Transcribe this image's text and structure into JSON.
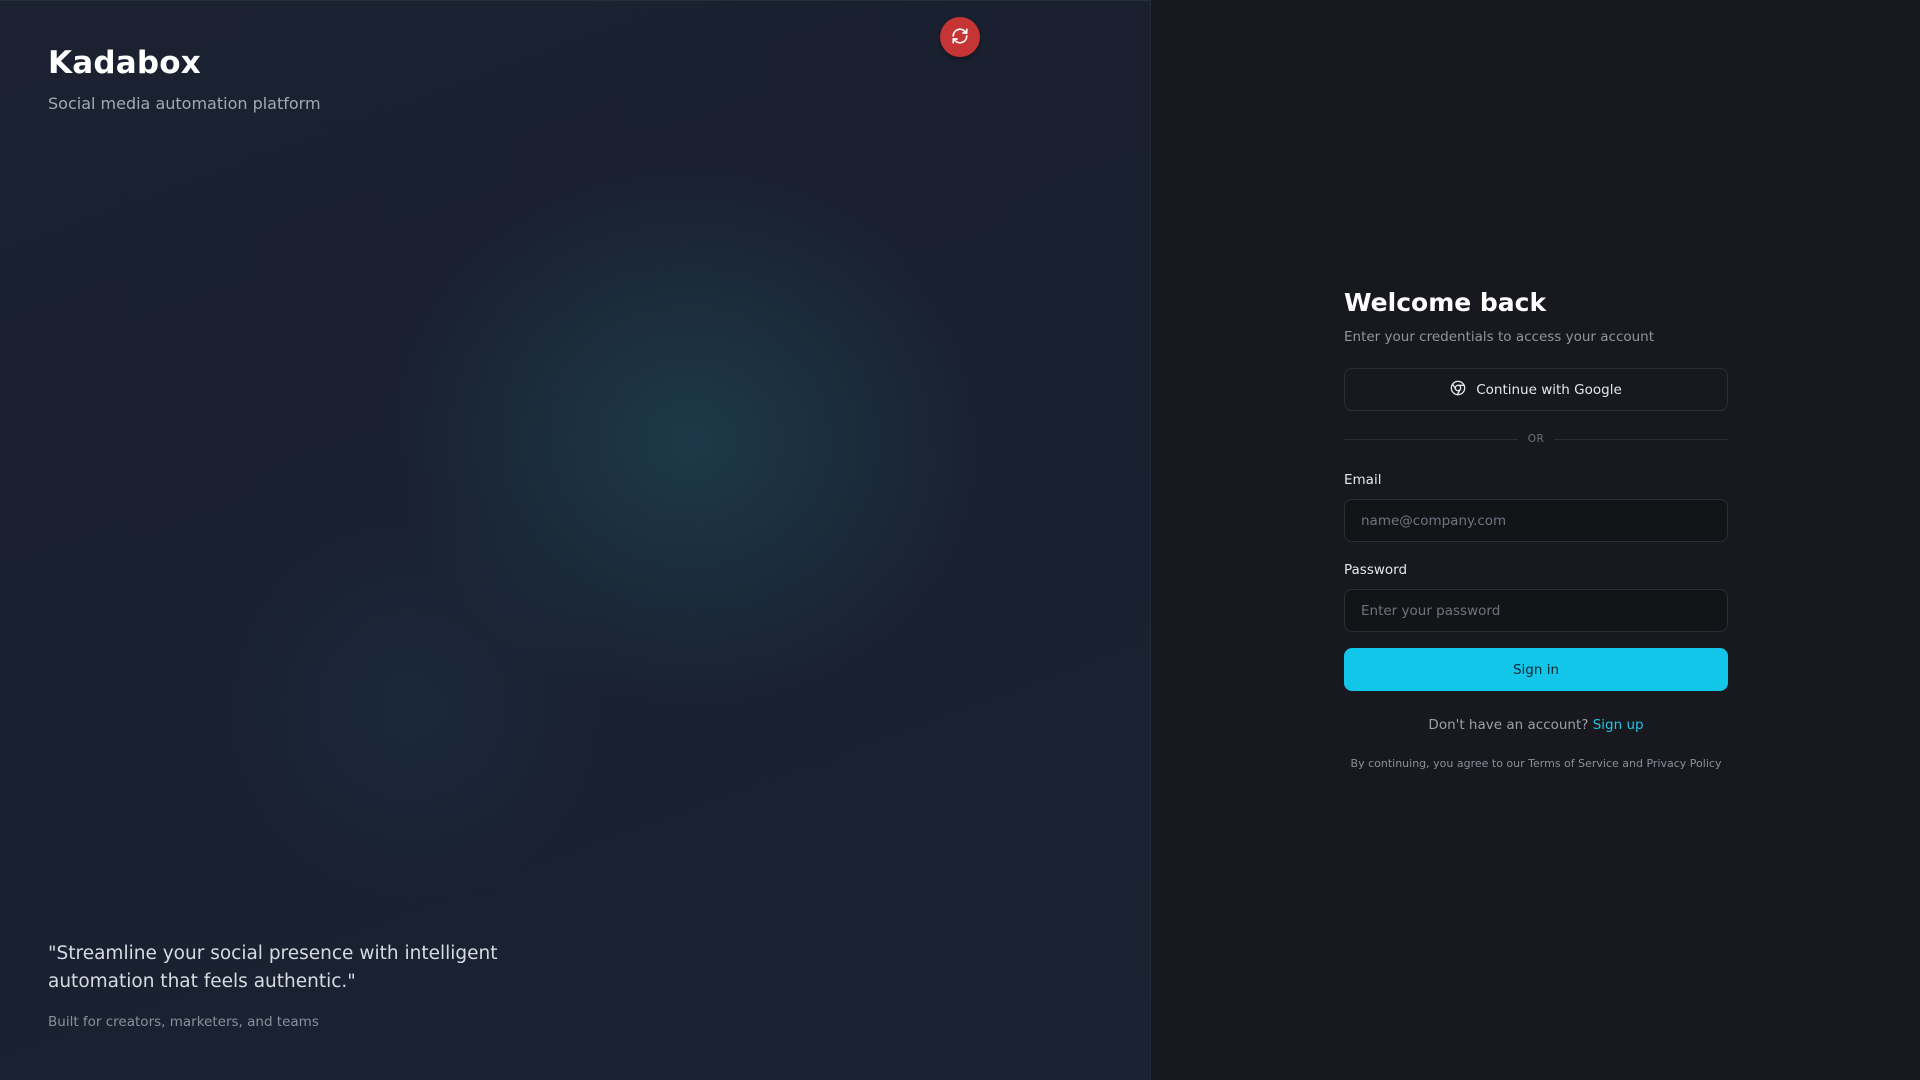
{
  "brand": {
    "title": "Kadabox",
    "tagline": "Social media automation platform",
    "quote": "\"Streamline your social presence with intelligent automation that feels authentic.\"",
    "quote_sub": "Built for creators, marketers, and teams",
    "refresh_icon": "refresh-icon"
  },
  "login": {
    "heading": "Welcome back",
    "subheading": "Enter your credentials to access your account",
    "google_label": "Continue with Google",
    "google_icon": "google-icon",
    "divider": "OR",
    "email": {
      "label": "Email",
      "placeholder": "name@company.com",
      "value": ""
    },
    "password": {
      "label": "Password",
      "placeholder": "Enter your password",
      "value": ""
    },
    "signin_label": "Sign in",
    "signup_prompt": "Don't have an account?",
    "signup_link": "Sign up",
    "terms": "By continuing, you agree to our Terms of Service and Privacy Policy"
  },
  "colors": {
    "accent": "#12c6e9",
    "refresh_button": "#c53535",
    "background": "#17191e"
  }
}
